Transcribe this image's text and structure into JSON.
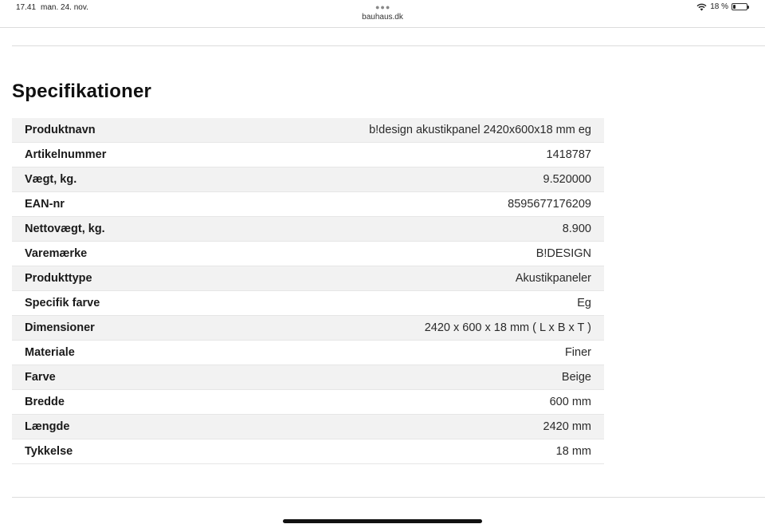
{
  "status_bar": {
    "time": "17.41",
    "date": "man. 24. nov.",
    "url": "bauhaus.dk",
    "battery_percent_label": "18 %",
    "battery_level": 0.18
  },
  "page": {
    "title": "Specifikationer"
  },
  "specs": [
    {
      "label": "Produktnavn",
      "value": "b!design akustikpanel 2420x600x18 mm eg"
    },
    {
      "label": "Artikelnummer",
      "value": "1418787"
    },
    {
      "label": "Vægt, kg.",
      "value": "9.520000"
    },
    {
      "label": "EAN-nr",
      "value": "8595677176209"
    },
    {
      "label": "Nettovægt, kg.",
      "value": "8.900"
    },
    {
      "label": "Varemærke",
      "value": "B!DESIGN"
    },
    {
      "label": "Produkttype",
      "value": "Akustikpaneler"
    },
    {
      "label": "Specifik farve",
      "value": "Eg"
    },
    {
      "label": "Dimensioner",
      "value": "2420 x 600 x 18 mm ( L x B x T )"
    },
    {
      "label": "Materiale",
      "value": "Finer"
    },
    {
      "label": "Farve",
      "value": "Beige"
    },
    {
      "label": "Bredde",
      "value": "600 mm"
    },
    {
      "label": "Længde",
      "value": "2420 mm"
    },
    {
      "label": "Tykkelse",
      "value": "18 mm"
    }
  ],
  "icons": {
    "wifi": "wifi-icon",
    "battery": "battery-icon",
    "menu_dots": "more-dots-icon"
  }
}
